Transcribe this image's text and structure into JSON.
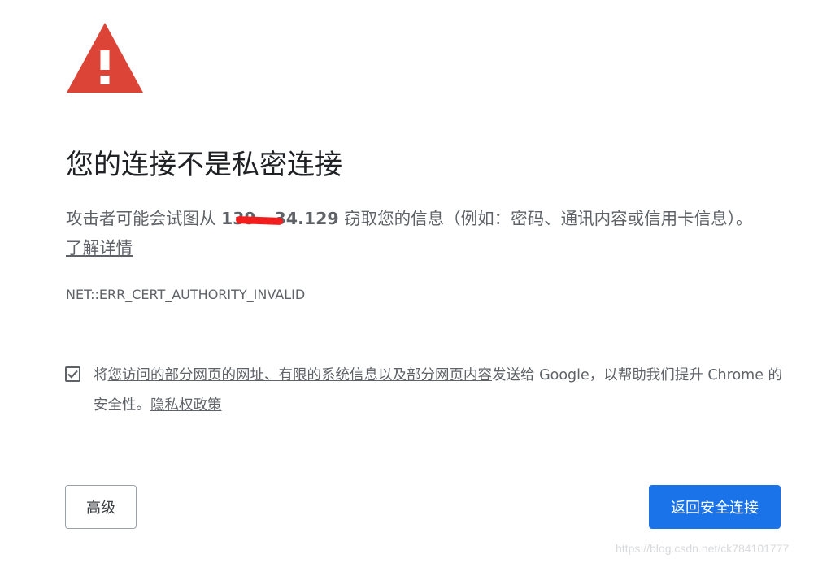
{
  "title": "您的连接不是私密连接",
  "explanation": {
    "prefix": "攻击者可能会试图从 ",
    "host": "139.  .34.129",
    "suffix": " 窃取您的信息（例如：密码、通讯内容或信用卡信息）。",
    "learn_more": "了解详情"
  },
  "error_code": "NET::ERR_CERT_AUTHORITY_INVALID",
  "optin": {
    "checked": true,
    "prefix": "将",
    "link_text": "您访问的部分网页的网址、有限的系统信息以及部分网页内容",
    "suffix": "发送给 Google，以帮助我们提升 Chrome 的安全性。",
    "privacy_link": "隐私权政策"
  },
  "buttons": {
    "advanced": "高级",
    "back_to_safety": "返回安全连接"
  },
  "watermark": "https://blog.csdn.net/ck784101777",
  "colors": {
    "warning_red": "#db4437",
    "primary_blue": "#1a73e8",
    "text_gray": "#5f6368"
  },
  "icons": {
    "warning": "warning-triangle-icon",
    "checkbox": "checkmark-icon"
  }
}
